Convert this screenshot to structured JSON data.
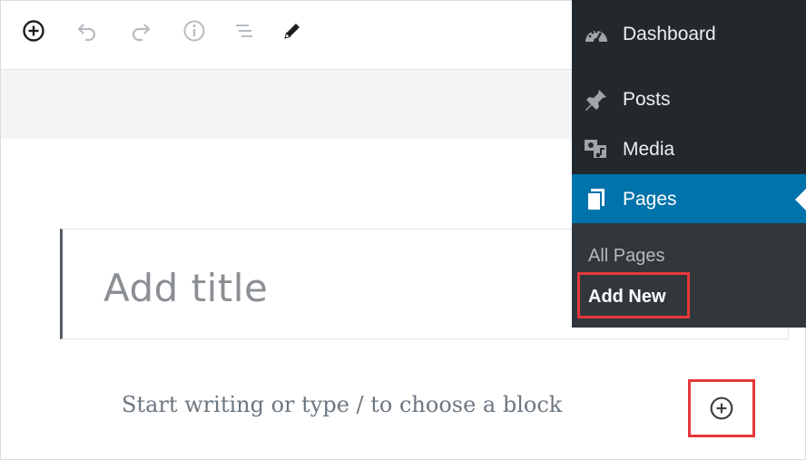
{
  "toolbar": {
    "tools": [
      {
        "icon": "plus-circle-icon",
        "state": "active"
      },
      {
        "icon": "undo-icon",
        "state": "disabled"
      },
      {
        "icon": "redo-icon",
        "state": "disabled"
      },
      {
        "icon": "info-icon",
        "state": "disabled"
      },
      {
        "icon": "list-view-icon",
        "state": "disabled"
      },
      {
        "icon": "pencil-icon",
        "state": "active"
      }
    ]
  },
  "editor": {
    "title_placeholder": "Add title",
    "block_placeholder": "Start writing or type / to choose a block"
  },
  "admin_menu": {
    "items": [
      {
        "label": "Dashboard",
        "icon": "dashboard-icon"
      },
      {
        "label": "Posts",
        "icon": "pushpin-icon"
      },
      {
        "label": "Media",
        "icon": "media-icon"
      },
      {
        "label": "Pages",
        "icon": "pages-icon",
        "active": true
      }
    ],
    "submenu": [
      {
        "label": "All Pages"
      },
      {
        "label": "Add New",
        "current": true
      }
    ]
  },
  "colors": {
    "menu_bg": "#23282d",
    "submenu_bg": "#32373c",
    "active_bg": "#0073aa",
    "highlight": "#e5383b"
  }
}
